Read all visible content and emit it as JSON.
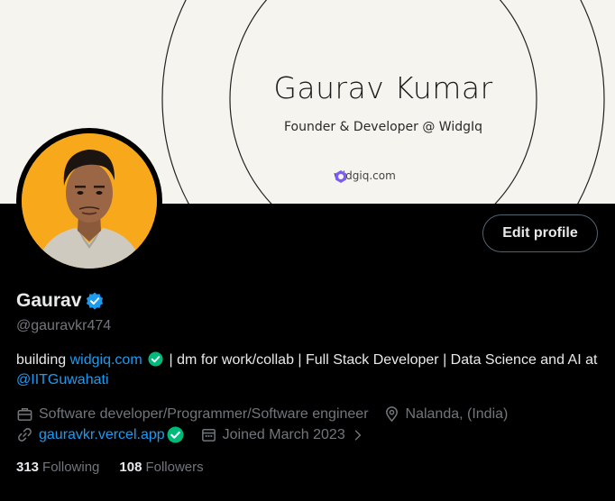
{
  "banner": {
    "title": "Gaurav Kumar",
    "subtitle": "Founder & Developer @ WidgIq",
    "site": "widgiq.com"
  },
  "profile": {
    "edit_button": "Edit profile",
    "name": "Gaurav",
    "handle": "@gauravkr474",
    "bio": {
      "prefix": "building ",
      "link": "widgiq.com",
      "middle": " | dm for work/collab | Full Stack Developer | Data Science and AI at ",
      "mention": "@IITGuwahati"
    },
    "profession": "Software developer/Programmer/Software engineer",
    "location": "Nalanda, (India)",
    "website": "gauravkr.vercel.app",
    "joined": "Joined March 2023",
    "following_count": "313",
    "following_label": "Following",
    "followers_count": "108",
    "followers_label": "Followers"
  },
  "colors": {
    "background": "#000000",
    "text": "#e7e9ea",
    "muted": "#71767b",
    "link": "#1d9bf0",
    "verified": "#1d9bf0",
    "affiliate_check": "#00ba7c",
    "banner": "#f6f4ef"
  }
}
